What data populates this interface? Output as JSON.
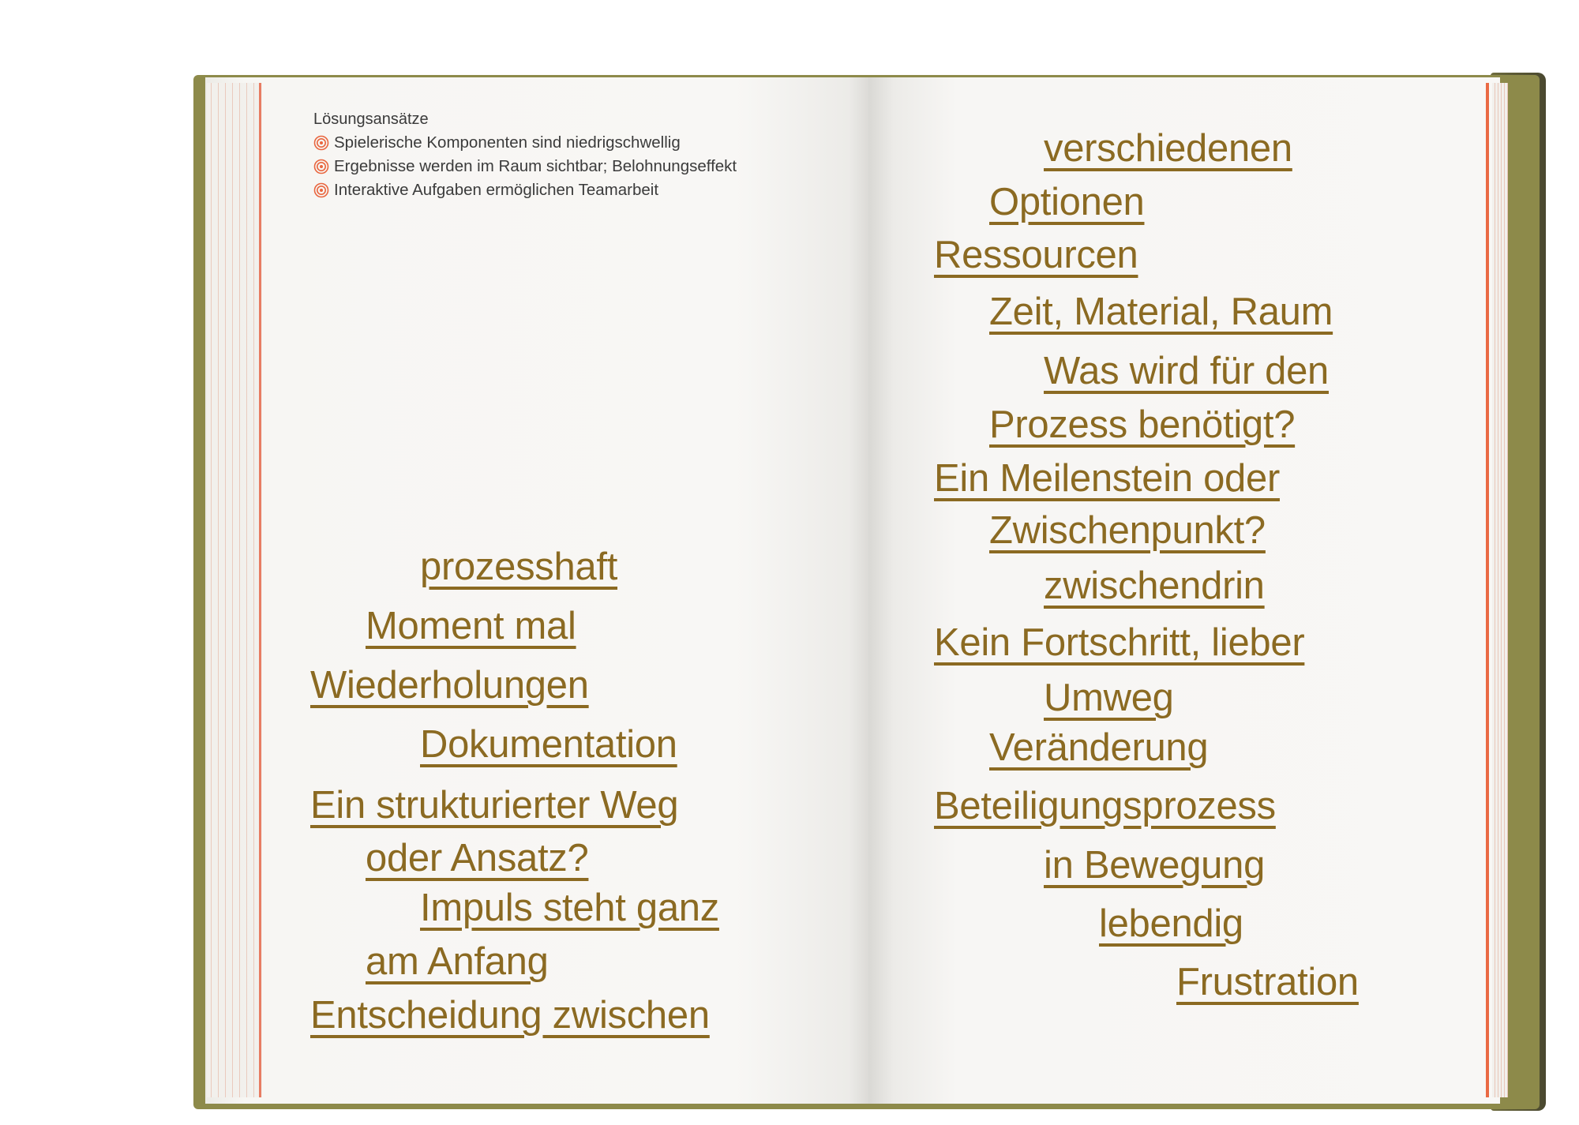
{
  "colors": {
    "text_accent": "#8b6a22",
    "bullet_icon": "#e9663f"
  },
  "left_page": {
    "heading": "Lösungsansätze",
    "bullets": [
      "Spielerische Komponenten sind niedrigschwellig",
      "Ergebnisse werden im Raum sichtbar; Belohnungseffekt",
      "Interaktive Aufgaben ermöglichen Teamarbeit"
    ],
    "bullet_icon": "concentric-circle-icon",
    "words": [
      "prozesshaft",
      "Moment mal",
      "Wiederholungen",
      "Dokumentation",
      "Ein strukturierter Weg",
      "oder Ansatz?",
      "Impuls steht ganz ",
      "am Anfang",
      "Entscheidung zwischen"
    ]
  },
  "right_page": {
    "words": [
      "verschiedenen",
      "Optionen",
      "Ressourcen",
      "Zeit, Material, Raum",
      "Was wird für den",
      "Prozess benötigt?",
      "Ein Meilenstein oder",
      "Zwischenpunkt?",
      "zwischendrin",
      "Kein Fortschritt, lieber",
      "Umweg",
      "Veränderung",
      "Beteiligungsprozess",
      "in Bewegung",
      "lebendig",
      "Frustration"
    ]
  }
}
